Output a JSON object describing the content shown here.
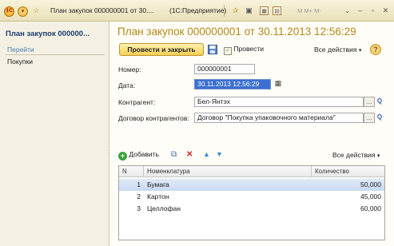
{
  "window": {
    "tab_title": "План закупок 000000001 от 30....",
    "app_name": "(1С:Предприятие)",
    "toolbar_text": "M  M+ M-"
  },
  "left_panel": {
    "title": "План закупок 000000...",
    "goto_label": "Перейти",
    "items": [
      {
        "label": "Покупки"
      }
    ]
  },
  "form": {
    "title": "План закупок 000000001 от 30.11.2013 12:56:29",
    "buttons": {
      "post_and_close": "Провести и закрыть",
      "post": "Провести",
      "all_actions": "Все действия",
      "help": "?"
    },
    "fields": {
      "number_label": "Номер:",
      "number_value": "000000001",
      "date_label": "Дата:",
      "date_value": "30.11.2013 12:56:29",
      "counterparty_label": "Контрагент:",
      "counterparty_value": "Бел-Янтэх",
      "contract_label": "Договор контрагентов:",
      "contract_value": "Договор \"Покупка упаковочного материала\""
    }
  },
  "table": {
    "toolbar": {
      "add_label": "Добавить",
      "all_actions": "Все действия"
    },
    "columns": [
      "N",
      "Номенклатура",
      "Количество"
    ],
    "rows": [
      {
        "n": "1",
        "item": "Бумага",
        "qty": "50,000"
      },
      {
        "n": "2",
        "item": "Картон",
        "qty": "45,000"
      },
      {
        "n": "3",
        "item": "Целлофан",
        "qty": "60,000"
      }
    ],
    "selected_row": 0
  },
  "colors": {
    "title_color": "#b3881a",
    "accent_yellow": "#f4cf55",
    "selection_blue": "#3a6fd1",
    "left_title_color": "#1d3c6f",
    "link_color": "#4a7bb5"
  }
}
